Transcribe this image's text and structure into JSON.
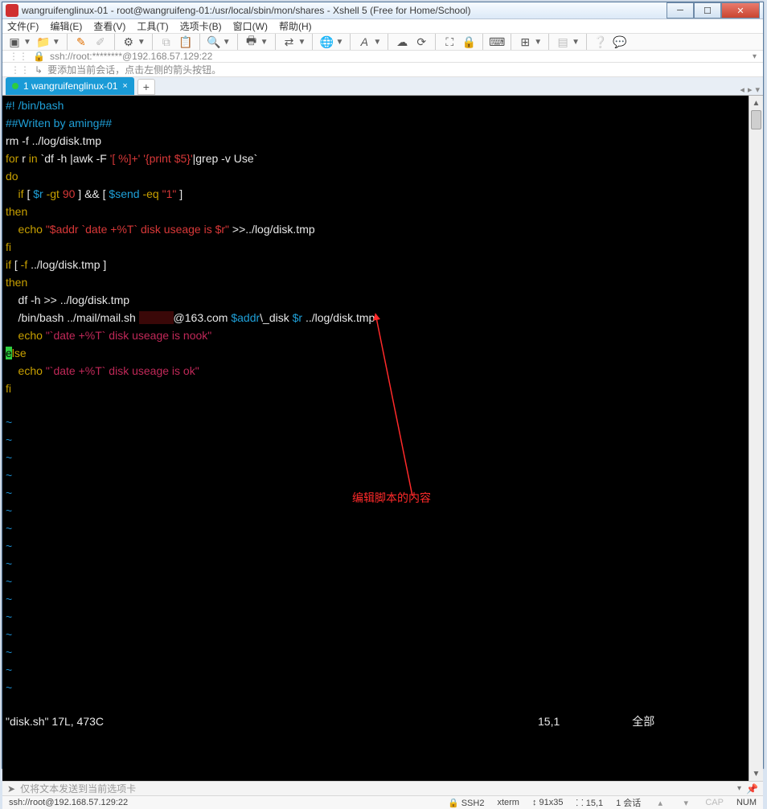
{
  "titlebar": {
    "title": "wangruifenglinux-01 - root@wangruifeng-01:/usr/local/sbin/mon/shares - Xshell 5 (Free for Home/School)"
  },
  "menu": {
    "file": "文件(F)",
    "edit": "编辑(E)",
    "view": "查看(V)",
    "tools": "工具(T)",
    "tabs": "选项卡(B)",
    "window": "窗口(W)",
    "help": "帮助(H)"
  },
  "addr": {
    "text": "ssh://root:********@192.168.57.129:22"
  },
  "hint": {
    "text": "要添加当前会话，点击左侧的箭头按钮。"
  },
  "tab": {
    "label": "1 wangruifenglinux-01"
  },
  "code": {
    "l1_a": "#!",
    "l1_b": " /bin/bash",
    "l2": "##Writen by aming##",
    "l3_a": "rm -f ../log/disk.tmp",
    "l4_a": "for",
    " l4_b": " r ",
    "l4_c": "in",
    "l4_d": " `df -h |awk -F ",
    "l4_e": "'[ %]+'",
    "l4_f": " ",
    "l4_g": "'{print $5}'",
    "l4_h": "|grep -v Use`",
    "l5": "do",
    "l6_a": "    if",
    "l6_b": " [ ",
    "l6_c": "$r",
    "l6_d": " -gt ",
    "l6_e": "90",
    "l6_f": " ] ",
    "l6_g": "&&",
    "l6_h": " [ ",
    "l6_i": "$send",
    "l6_j": " -eq ",
    "l6_k": "\"1\"",
    "l6_l": " ]",
    "l7": "then",
    "l8_a": "    echo ",
    "l8_b": "\"$addr `date +%T` disk useage is $r\"",
    "l8_c": " >>../log/disk.tmp",
    "l9": "fi",
    "l10_a": "if",
    "l10_b": " [ ",
    "l10_c": "-f",
    "l10_d": " ../log/disk.tmp ]",
    "l11": "then",
    "l12": "    df -h >> ../log/disk.tmp",
    "l13_a": "    /bin/bash ../mail/mail.sh ",
    "l13_b": "           ",
    "l13_c": "@163.com ",
    "l13_d": "$addr",
    "l13_e": "\\_disk ",
    "l13_f": "$r",
    "l13_g": " ../log/disk.tmp",
    "l14_a": "    echo ",
    "l14_b": "\"`date +%T` disk useage is nook\"",
    "l15_a": "e",
    "l15_b": "lse",
    "l16_a": "    echo ",
    "l16_b": "\"`date +%T` disk useage is ok\"",
    "l17": "fi",
    "status_a": "\"disk.sh\" 17L, 473C",
    "status_pos": "15,1",
    "status_all": "全部"
  },
  "annot": {
    "label": "编辑脚本的内容"
  },
  "inputrow": {
    "hint": "仅将文本发送到当前选项卡"
  },
  "status": {
    "ssh": "ssh://root@192.168.57.129:22",
    "proto": "SSH2",
    "term": "xterm",
    "size": "91x35",
    "pos": "15,1",
    "sess": "1 会话",
    "cap": "CAP",
    "num": "NUM"
  }
}
